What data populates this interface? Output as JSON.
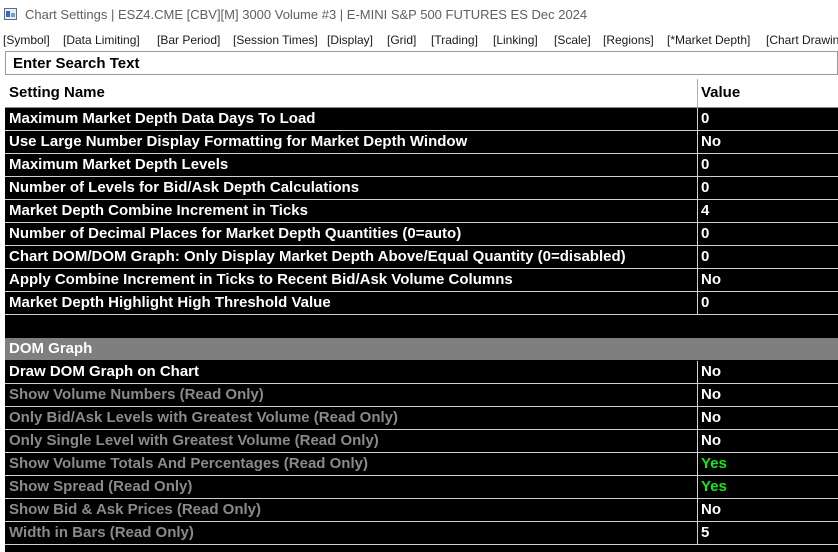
{
  "window": {
    "title": "Chart Settings | ESZ4.CME [CBV][M]  3000 Volume #3 | E-MINI S&P 500 FUTURES ES Dec 2024"
  },
  "tabs": [
    {
      "label": "[Symbol]"
    },
    {
      "label": "[Data Limiting]"
    },
    {
      "label": "[Bar Period]"
    },
    {
      "label": "[Session Times]"
    },
    {
      "label": "[Display]"
    },
    {
      "label": "[Grid]"
    },
    {
      "label": "[Trading]"
    },
    {
      "label": "[Linking]"
    },
    {
      "label": "[Scale]"
    },
    {
      "label": "[Regions]"
    },
    {
      "label": "[*Market Depth]"
    },
    {
      "label": "[Chart Drawin"
    }
  ],
  "search": {
    "placeholder": "Enter Search Text",
    "value": ""
  },
  "table": {
    "headers": {
      "name": "Setting Name",
      "value": "Value"
    },
    "rows": [
      {
        "name": "Maximum Market Depth Data Days To Load",
        "value": "0"
      },
      {
        "name": "Use Large Number Display Formatting for Market Depth Window",
        "value": "No"
      },
      {
        "name": "Maximum Market Depth Levels",
        "value": "0"
      },
      {
        "name": "Number of Levels for Bid/Ask Depth Calculations",
        "value": "0"
      },
      {
        "name": "Market Depth Combine Increment in Ticks",
        "value": "4"
      },
      {
        "name": "Number of Decimal Places for Market Depth Quantities (0=auto)",
        "value": "0"
      },
      {
        "name": "Chart DOM/DOM Graph: Only Display Market Depth Above/Equal Quantity (0=disabled)",
        "value": "0"
      },
      {
        "name": "Apply Combine Increment in Ticks to Recent Bid/Ask Volume Columns",
        "value": "No"
      },
      {
        "name": "Market Depth Highlight High Threshold Value",
        "value": "0"
      }
    ],
    "section": {
      "title": "DOM Graph"
    },
    "section_rows": [
      {
        "name": "Draw DOM Graph on Chart",
        "value": "No",
        "read_only": false
      },
      {
        "name": "Show Volume Numbers (Read Only)",
        "value": "No",
        "read_only": true
      },
      {
        "name": "Only Bid/Ask Levels with Greatest Volume (Read Only)",
        "value": "No",
        "read_only": true
      },
      {
        "name": "Only Single Level with Greatest Volume (Read Only)",
        "value": "No",
        "read_only": true
      },
      {
        "name": "Show Volume Totals And Percentages (Read Only)",
        "value": "Yes",
        "read_only": true
      },
      {
        "name": "Show Spread (Read Only)",
        "value": "Yes",
        "read_only": true
      },
      {
        "name": "Show Bid & Ask Prices (Read Only)",
        "value": "No",
        "read_only": true
      },
      {
        "name": "Width in Bars (Read Only)",
        "value": "5",
        "read_only": true
      }
    ]
  },
  "colors": {
    "grid_background": "#000000",
    "section_background": "#7f7f7f",
    "read_only_text": "#8a8a8a",
    "yes_value": "#19e619"
  }
}
